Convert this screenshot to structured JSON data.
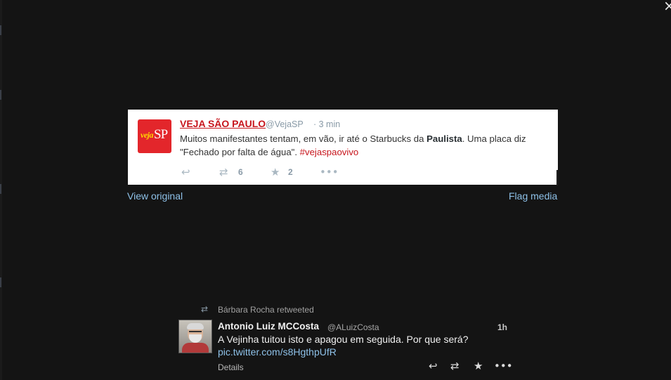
{
  "window": {
    "close_label": "×"
  },
  "media": {
    "embedded_tweet": {
      "logo": {
        "veja": "veja",
        "sp": "SP"
      },
      "name": "VEJA SÃO PAULO",
      "handle": "@VejaSP",
      "time": "· 3 min",
      "text_part1": "Muitos manifestantes tentam, em vão, ir até o Starbucks da ",
      "text_bold": "Paulista",
      "text_part2": ". Uma placa diz \"Fechado por falta de água\". ",
      "hashtag": "#vejaspaovivo",
      "retweet_count": "6",
      "favorite_count": "2",
      "icons": {
        "reply": "reply-icon",
        "retweet": "retweet-icon",
        "favorite": "star-icon",
        "more": "more-icon"
      },
      "colors": {
        "brand_red": "#c7151c",
        "logo_red": "#e3262b",
        "logo_yellow": "#ffd700"
      }
    },
    "view_original": "View original",
    "flag_media": "Flag media",
    "link_color": "#8ec1e8"
  },
  "tweet": {
    "retweet_context": "Bárbara Rocha retweeted",
    "author_name": "Antonio Luiz MCCosta",
    "author_handle": "@ALuizCosta",
    "time": "1h",
    "text": "A Vejinha tuitou isto e apagou em seguida. Por que será?",
    "link": "pic.twitter.com/s8HgthpUfR",
    "details": "Details",
    "icons": {
      "reply": "reply-icon",
      "retweet": "retweet-icon",
      "favorite": "star-icon",
      "more": "more-icon"
    }
  }
}
